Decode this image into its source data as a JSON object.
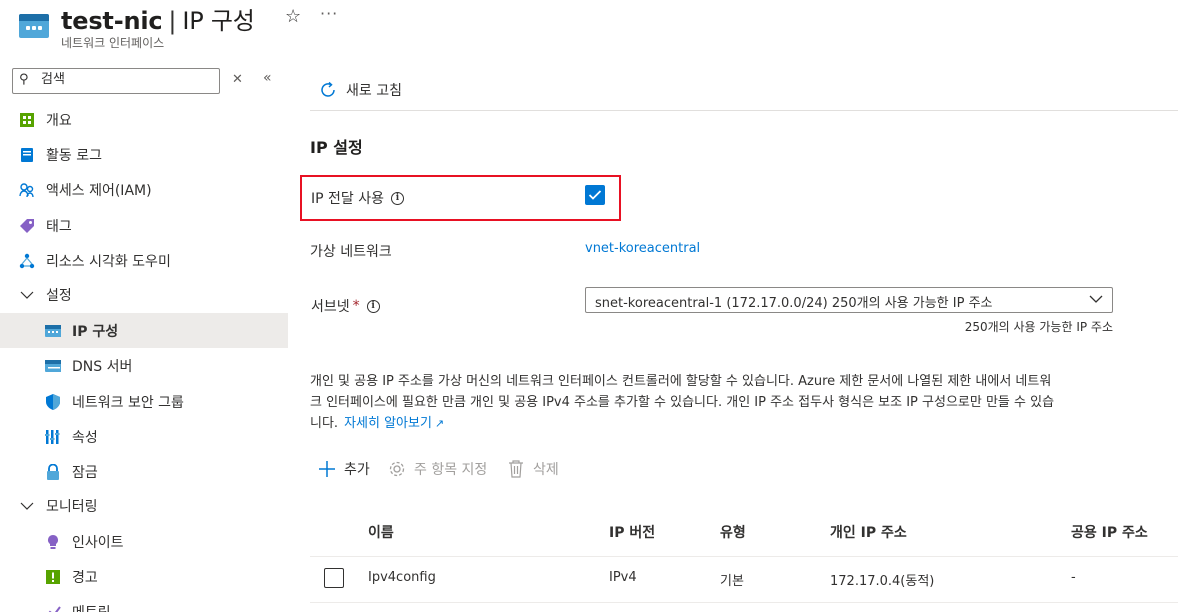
{
  "header": {
    "resource_name": "test-nic",
    "separator": "|",
    "page_name": "IP 구성",
    "subtitle": "네트워크 인터페이스",
    "favorite_icon": "star-icon",
    "more_icon": "more-icon"
  },
  "sidebar": {
    "search_placeholder": "검색",
    "items": [
      {
        "label": "개요",
        "icon": "overview-icon"
      },
      {
        "label": "활동 로그",
        "icon": "activity-log-icon"
      },
      {
        "label": "액세스 제어(IAM)",
        "icon": "people-icon"
      },
      {
        "label": "태그",
        "icon": "tag-icon"
      },
      {
        "label": "리소스 시각화 도우미",
        "icon": "visualizer-icon"
      },
      {
        "label": "설정",
        "icon": "chevron-down-icon",
        "group": true
      },
      {
        "label": "IP 구성",
        "icon": "ip-config-icon",
        "selected": true
      },
      {
        "label": "DNS 서버",
        "icon": "dns-icon"
      },
      {
        "label": "네트워크 보안 그룹",
        "icon": "shield-icon"
      },
      {
        "label": "속성",
        "icon": "properties-icon"
      },
      {
        "label": "잠금",
        "icon": "lock-icon"
      },
      {
        "label": "모니터링",
        "icon": "chevron-down-icon",
        "group": true
      },
      {
        "label": "인사이트",
        "icon": "insights-icon"
      },
      {
        "label": "경고",
        "icon": "alert-icon"
      },
      {
        "label": "메트릭",
        "icon": "metrics-icon"
      }
    ]
  },
  "toolbar": {
    "refresh_label": "새로 고침"
  },
  "ip_settings": {
    "title": "IP 설정",
    "forwarding_label": "IP 전달 사용",
    "forwarding_enabled": true,
    "vnet_label": "가상 네트워크",
    "vnet_value": "vnet-koreacentral",
    "subnet_label": "서브넷",
    "subnet_required": "*",
    "subnet_value": "snet-koreacentral-1 (172.17.0.0/24) 250개의 사용 가능한 IP 주소",
    "subnet_hint": "250개의 사용 가능한 IP 주소"
  },
  "description": {
    "line1": "개인 및 공용 IP 주소를 가상 머신의 네트워크 인터페이스 컨트롤러에 할당할 수 있습니다. Azure 제한 문서에 나열된 제한 내에서 네트워",
    "line2": "크 인터페이스에 필요한 만큼 개인 및 공용 IPv4 주소를 추가할 수 있습니다. 개인 IP 주소 접두사 형식은 보조 IP 구성으로만 만들 수 있습",
    "line3": "니다.",
    "learn_more": "자세히 알아보기"
  },
  "commands": {
    "add": "추가",
    "make_primary": "주 항목 지정",
    "delete": "삭제"
  },
  "table": {
    "headers": [
      "이름",
      "IP 버전",
      "유형",
      "개인 IP 주소",
      "공용 IP 주소"
    ],
    "rows": [
      {
        "name": "Ipv4config",
        "version": "IPv4",
        "type": "기본",
        "private_ip": "172.17.0.4(동적)",
        "public_ip": "-"
      }
    ]
  },
  "colors": {
    "accent": "#0078d4",
    "highlight_border": "#e81123",
    "selected_bg": "#edebe9"
  }
}
